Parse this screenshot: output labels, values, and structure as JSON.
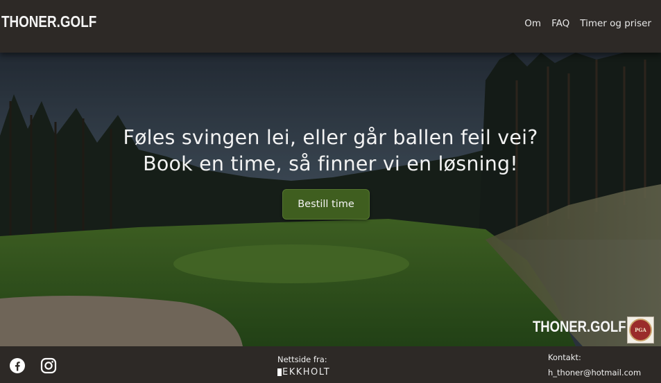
{
  "header": {
    "logo": "THONER.GOLF",
    "nav": [
      {
        "label": "Om"
      },
      {
        "label": "FAQ"
      },
      {
        "label": "Timer og priser"
      }
    ]
  },
  "hero": {
    "headline_line1": "Føles svingen lei, eller går ballen feil vei?",
    "headline_line2": "Book en time, så finner vi en løsning!",
    "cta_label": "Bestill time",
    "logo": "THONER.GOLF",
    "badge_text": "PGA"
  },
  "footer": {
    "social": [
      {
        "icon": "facebook-icon"
      },
      {
        "icon": "instagram-icon"
      }
    ],
    "credit_label": "Nettside fra:",
    "credit_brand": "EKKHOLT",
    "contact_label": "Kontakt:",
    "contact_email": "h_thoner@hotmail.com"
  },
  "colors": {
    "header_bg": "#2d2926",
    "cta_bg": "#3f5e1f",
    "text": "#ffffff"
  }
}
